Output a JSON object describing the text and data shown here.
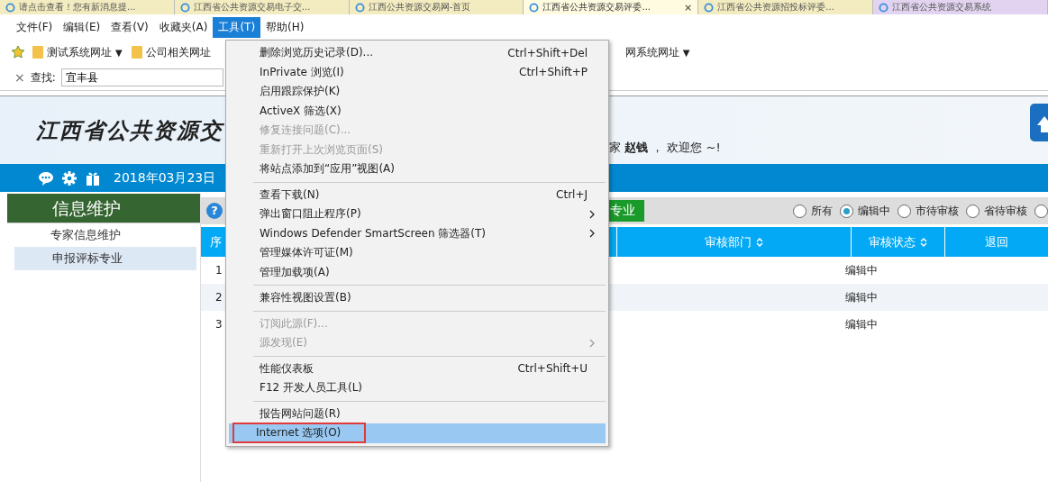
{
  "browser_tabs": [
    {
      "title": "请点击查看！您有新消息提...",
      "selected": false
    },
    {
      "title": "江西省公共资源交易电子交...",
      "selected": false
    },
    {
      "title": "江西公共资源交易网-首页",
      "selected": false
    },
    {
      "title": "江西省公共资源交易评委...",
      "selected": true,
      "close": "×"
    },
    {
      "title": "江西省公共资源招投标评委...",
      "selected": false
    },
    {
      "title": "江西省公共资源交易系统",
      "selected": false
    }
  ],
  "menu_bar": [
    {
      "label": "文件(F)",
      "selected": false
    },
    {
      "label": "编辑(E)",
      "selected": false
    },
    {
      "label": "查看(V)",
      "selected": false
    },
    {
      "label": "收藏夹(A)",
      "selected": false
    },
    {
      "label": "工具(T)",
      "selected": true
    },
    {
      "label": "帮助(H)",
      "selected": false
    }
  ],
  "favorites_bar": [
    {
      "label": "测试系统网址",
      "arrow": "▼"
    },
    {
      "label": "公司相关网址"
    },
    {
      "label": "网系统网址",
      "arrow": "▼"
    }
  ],
  "find_bar": {
    "close": "×",
    "label": "查找:",
    "value": "宜丰县"
  },
  "header": {
    "title": "江西省公共资源交",
    "greeting": "家 **赵钱** ， 欢迎您 ~!"
  },
  "nav_bar": {
    "date": "2018年03月23日"
  },
  "sidebar": {
    "title": "信息维护",
    "items": [
      {
        "label": "专家信息维护",
        "selected": false
      },
      {
        "label": "申报评标专业",
        "selected": true
      }
    ]
  },
  "toolbar": {
    "help": "?",
    "button": "专业",
    "filters": [
      {
        "label": "所有",
        "selected": false
      },
      {
        "label": "编辑中",
        "selected": true
      },
      {
        "label": "市待审核",
        "selected": false
      },
      {
        "label": "省待审核",
        "selected": false
      },
      {
        "selected": false
      }
    ]
  },
  "table": {
    "columns": [
      {
        "label": "序"
      },
      {
        "label": "审核部门",
        "sortable": true
      },
      {
        "label": "审核状态",
        "sortable": true
      },
      {
        "label": "退回",
        "sortable": false
      }
    ],
    "rows": [
      {
        "number": "1",
        "status": "编辑中"
      },
      {
        "number": "2",
        "status": "编辑中"
      },
      {
        "number": "3",
        "status": "编辑中"
      }
    ]
  },
  "tools_menu": [
    {
      "kind": "item",
      "label": "删除浏览历史记录(D)...",
      "shortcut": "Ctrl+Shift+Del",
      "disabled": false,
      "submenu": false,
      "highlighted": false,
      "outlined": false
    },
    {
      "kind": "item",
      "label": "InPrivate 浏览(I)",
      "shortcut": "Ctrl+Shift+P",
      "disabled": false,
      "submenu": false,
      "highlighted": false,
      "outlined": false
    },
    {
      "kind": "item",
      "label": "启用跟踪保护(K)",
      "disabled": false,
      "submenu": false,
      "highlighted": false,
      "outlined": false
    },
    {
      "kind": "item",
      "label": "ActiveX 筛选(X)",
      "disabled": false,
      "submenu": false,
      "highlighted": false,
      "outlined": false
    },
    {
      "kind": "item",
      "label": "修复连接问题(C)...",
      "disabled": true,
      "submenu": false,
      "highlighted": false,
      "outlined": false
    },
    {
      "kind": "item",
      "label": "重新打开上次浏览页面(S)",
      "disabled": true,
      "submenu": false,
      "highlighted": false,
      "outlined": false
    },
    {
      "kind": "item",
      "label": "将站点添加到“应用”视图(A)",
      "disabled": false,
      "submenu": false,
      "highlighted": false,
      "outlined": false
    },
    {
      "kind": "separator"
    },
    {
      "kind": "item",
      "label": "查看下载(N)",
      "shortcut": "Ctrl+J",
      "disabled": false,
      "submenu": false,
      "highlighted": false,
      "outlined": false
    },
    {
      "kind": "item",
      "label": "弹出窗口阻止程序(P)",
      "disabled": false,
      "submenu": true,
      "highlighted": false,
      "outlined": false
    },
    {
      "kind": "item",
      "label": "Windows Defender SmartScreen 筛选器(T)",
      "disabled": false,
      "submenu": true,
      "highlighted": false,
      "outlined": false
    },
    {
      "kind": "item",
      "label": "管理媒体许可证(M)",
      "disabled": false,
      "submenu": false,
      "highlighted": false,
      "outlined": false
    },
    {
      "kind": "item",
      "label": "管理加载项(A)",
      "disabled": false,
      "submenu": false,
      "highlighted": false,
      "outlined": false
    },
    {
      "kind": "separator"
    },
    {
      "kind": "item",
      "label": "兼容性视图设置(B)",
      "disabled": false,
      "submenu": false,
      "highlighted": false,
      "outlined": false
    },
    {
      "kind": "separator"
    },
    {
      "kind": "item",
      "label": "订阅此源(F)...",
      "disabled": true,
      "submenu": false,
      "highlighted": false,
      "outlined": false
    },
    {
      "kind": "item",
      "label": "源发现(E)",
      "disabled": true,
      "submenu": true,
      "highlighted": false,
      "outlined": false
    },
    {
      "kind": "separator"
    },
    {
      "kind": "item",
      "label": "性能仪表板",
      "shortcut": "Ctrl+Shift+U",
      "disabled": false,
      "submenu": false,
      "highlighted": false,
      "outlined": false
    },
    {
      "kind": "item",
      "label": "F12 开发人员工具(L)",
      "disabled": false,
      "submenu": false,
      "highlighted": false,
      "outlined": false
    },
    {
      "kind": "separator"
    },
    {
      "kind": "item",
      "label": "报告网站问题(R)",
      "disabled": false,
      "submenu": false,
      "highlighted": false,
      "outlined": false
    },
    {
      "kind": "item",
      "label": "Internet 选项(O)",
      "disabled": false,
      "submenu": false,
      "highlighted": true,
      "outlined": true
    }
  ]
}
